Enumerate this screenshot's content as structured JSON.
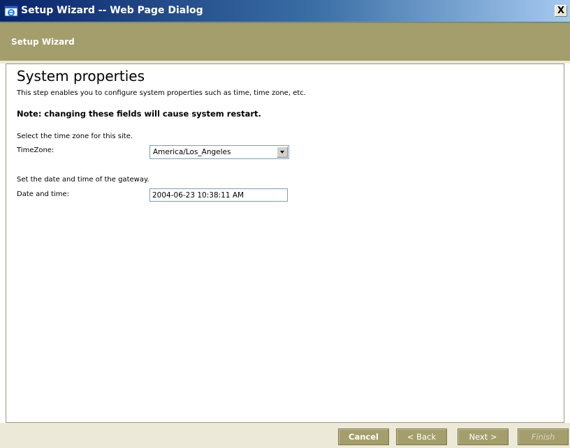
{
  "window": {
    "title": "Setup Wizard -- Web Page Dialog",
    "close_label": "X"
  },
  "header": {
    "title": "Setup Wizard"
  },
  "page": {
    "title": "System properties",
    "subtitle": "This step enables you to configure system properties such as time, time zone, etc.",
    "note": "Note: changing these fields will cause system restart."
  },
  "timezone": {
    "section_label": "Select the time zone for this site.",
    "field_label": "TimeZone:",
    "value": "America/Los_Angeles"
  },
  "datetime": {
    "section_label": "Set the date and time of the gateway.",
    "field_label": "Date and time:",
    "value": "2004-06-23 10:38:11 AM"
  },
  "footer": {
    "cancel_label": "Cancel",
    "back_label": "< Back",
    "next_label": "Next >",
    "finish_label": "Finish"
  },
  "colors": {
    "header_bg": "#a39e6b",
    "button_bg": "#a39e6b",
    "titlebar_start": "#0a246a",
    "titlebar_end": "#a6caf0"
  },
  "icons": {
    "app": "ie-window-icon",
    "close": "close-icon",
    "dropdown": "chevron-down-icon"
  }
}
